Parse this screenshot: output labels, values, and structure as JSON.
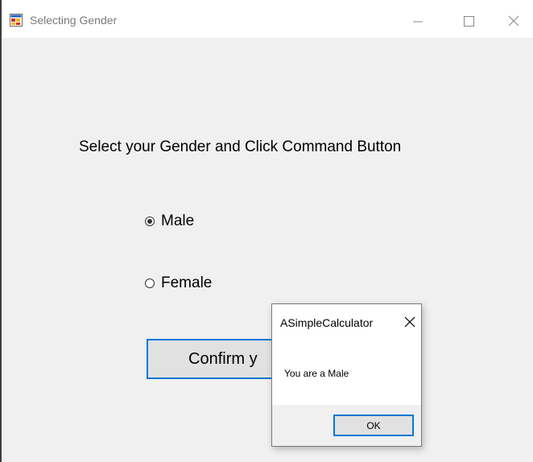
{
  "window": {
    "title": "Selecting Gender",
    "icon": "winforms-app-icon",
    "controls": [
      "minimize-icon",
      "maximize-icon",
      "close-icon"
    ]
  },
  "form": {
    "prompt": "Select your Gender and Click Command Button",
    "options": [
      {
        "label": "Male",
        "checked": true
      },
      {
        "label": "Female",
        "checked": false
      }
    ],
    "confirm_label": "Confirm y"
  },
  "dialog": {
    "title": "ASimpleCalculator",
    "message": "You are a Male",
    "ok_label": "OK"
  },
  "colors": {
    "accent": "#0078d7",
    "window_background": "#f0f0f0",
    "button_face": "#e1e1e1",
    "titlebar": "#ffffff"
  }
}
